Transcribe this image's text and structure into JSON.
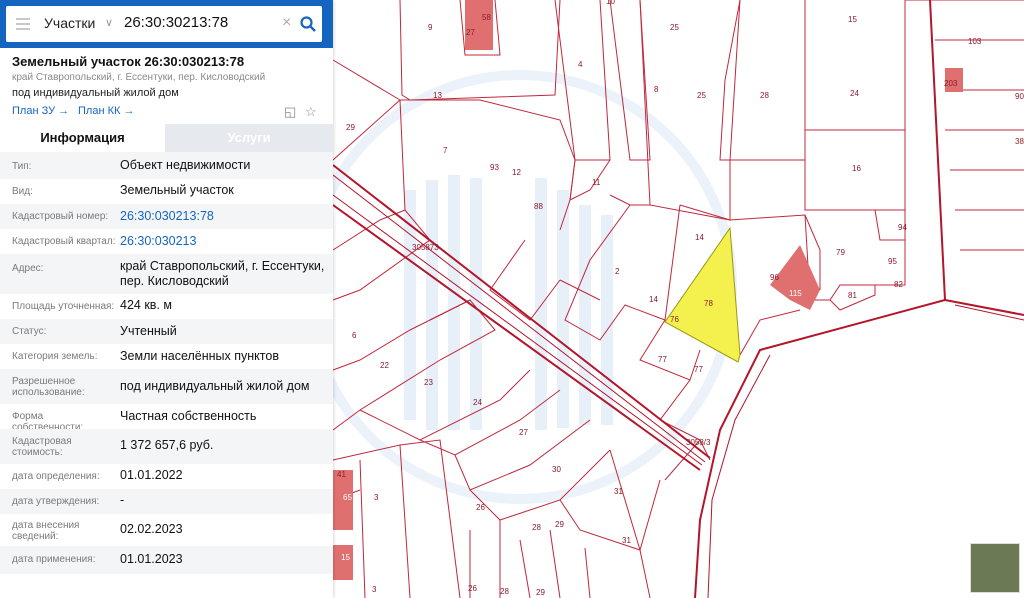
{
  "search": {
    "category": "Участки",
    "query": "26:30:30213:78"
  },
  "parcel": {
    "title": "Земельный участок 26:30:030213:78",
    "address_small": "край Ставропольский, г. Ессентуки, пер. Кисловодский",
    "usage": "под индивидуальный жилой дом",
    "plan_zu": "План ЗУ",
    "plan_kk": "План КК"
  },
  "tabs": {
    "info": "Информация",
    "services": "Услуги"
  },
  "details": [
    {
      "label": "Тип:",
      "value": "Объект недвижимости"
    },
    {
      "label": "Вид:",
      "value": "Земельный участок"
    },
    {
      "label": "Кадастровый номер:",
      "value": "26:30:030213:78"
    },
    {
      "label": "Кадастровый квартал:",
      "value": "26:30:030213"
    },
    {
      "label": "Адрес:",
      "value": "край Ставропольский, г. Ессентуки, пер. Кисловодский"
    },
    {
      "label": "Площадь уточненная:",
      "value": "424 кв. м"
    },
    {
      "label": "Статус:",
      "value": "Учтенный"
    },
    {
      "label": "Категория земель:",
      "value": "Земли населённых пунктов"
    },
    {
      "label": "Разрешенное использование:",
      "value": "под индивидуальный жилой дом"
    },
    {
      "label": "Форма собственности:",
      "value": "Частная собственность"
    },
    {
      "label": "Кадастровая стоимость:",
      "value": "1 372 657,6 руб."
    },
    {
      "label": "дата определения:",
      "value": "01.01.2022"
    },
    {
      "label": "дата утверждения:",
      "value": "-"
    },
    {
      "label": "дата внесения сведений:",
      "value": "02.02.2023"
    },
    {
      "label": "дата применения:",
      "value": "01.01.2023"
    }
  ],
  "map_labels": {
    "l1": "9",
    "l2": "58",
    "l3": "27",
    "l4": "10",
    "l5": "25",
    "l6": "15",
    "l7": "103",
    "l8": "4",
    "l9": "8",
    "l10": "25",
    "l11": "28",
    "l12": "24",
    "l13": "90",
    "l14": "13",
    "l15": "29",
    "l16": "7",
    "l17": "93",
    "l18": "12",
    "l19": "11",
    "l20": "38",
    "l21": "16",
    "l22": "88",
    "l23": "305873",
    "l24": "14",
    "l25": "94",
    "l26": "79",
    "l27": "95",
    "l28": "2",
    "l29": "96",
    "l30": "115",
    "l31": "81",
    "l32": "82",
    "l33": "14",
    "l34": "78",
    "l35": "76",
    "l36": "6",
    "l37": "77",
    "l38": "77",
    "l39": "22",
    "l40": "23",
    "l41": "24",
    "l42": "27",
    "l43": "3058/3",
    "l44": "30",
    "l45": "41",
    "l46": "3",
    "l47": "26",
    "l48": "28",
    "l49": "29",
    "l50": "31",
    "l51": "26",
    "l52": "28",
    "l53": "29",
    "l54": "3",
    "l55": "65",
    "l56": "15",
    "l57": "203"
  }
}
